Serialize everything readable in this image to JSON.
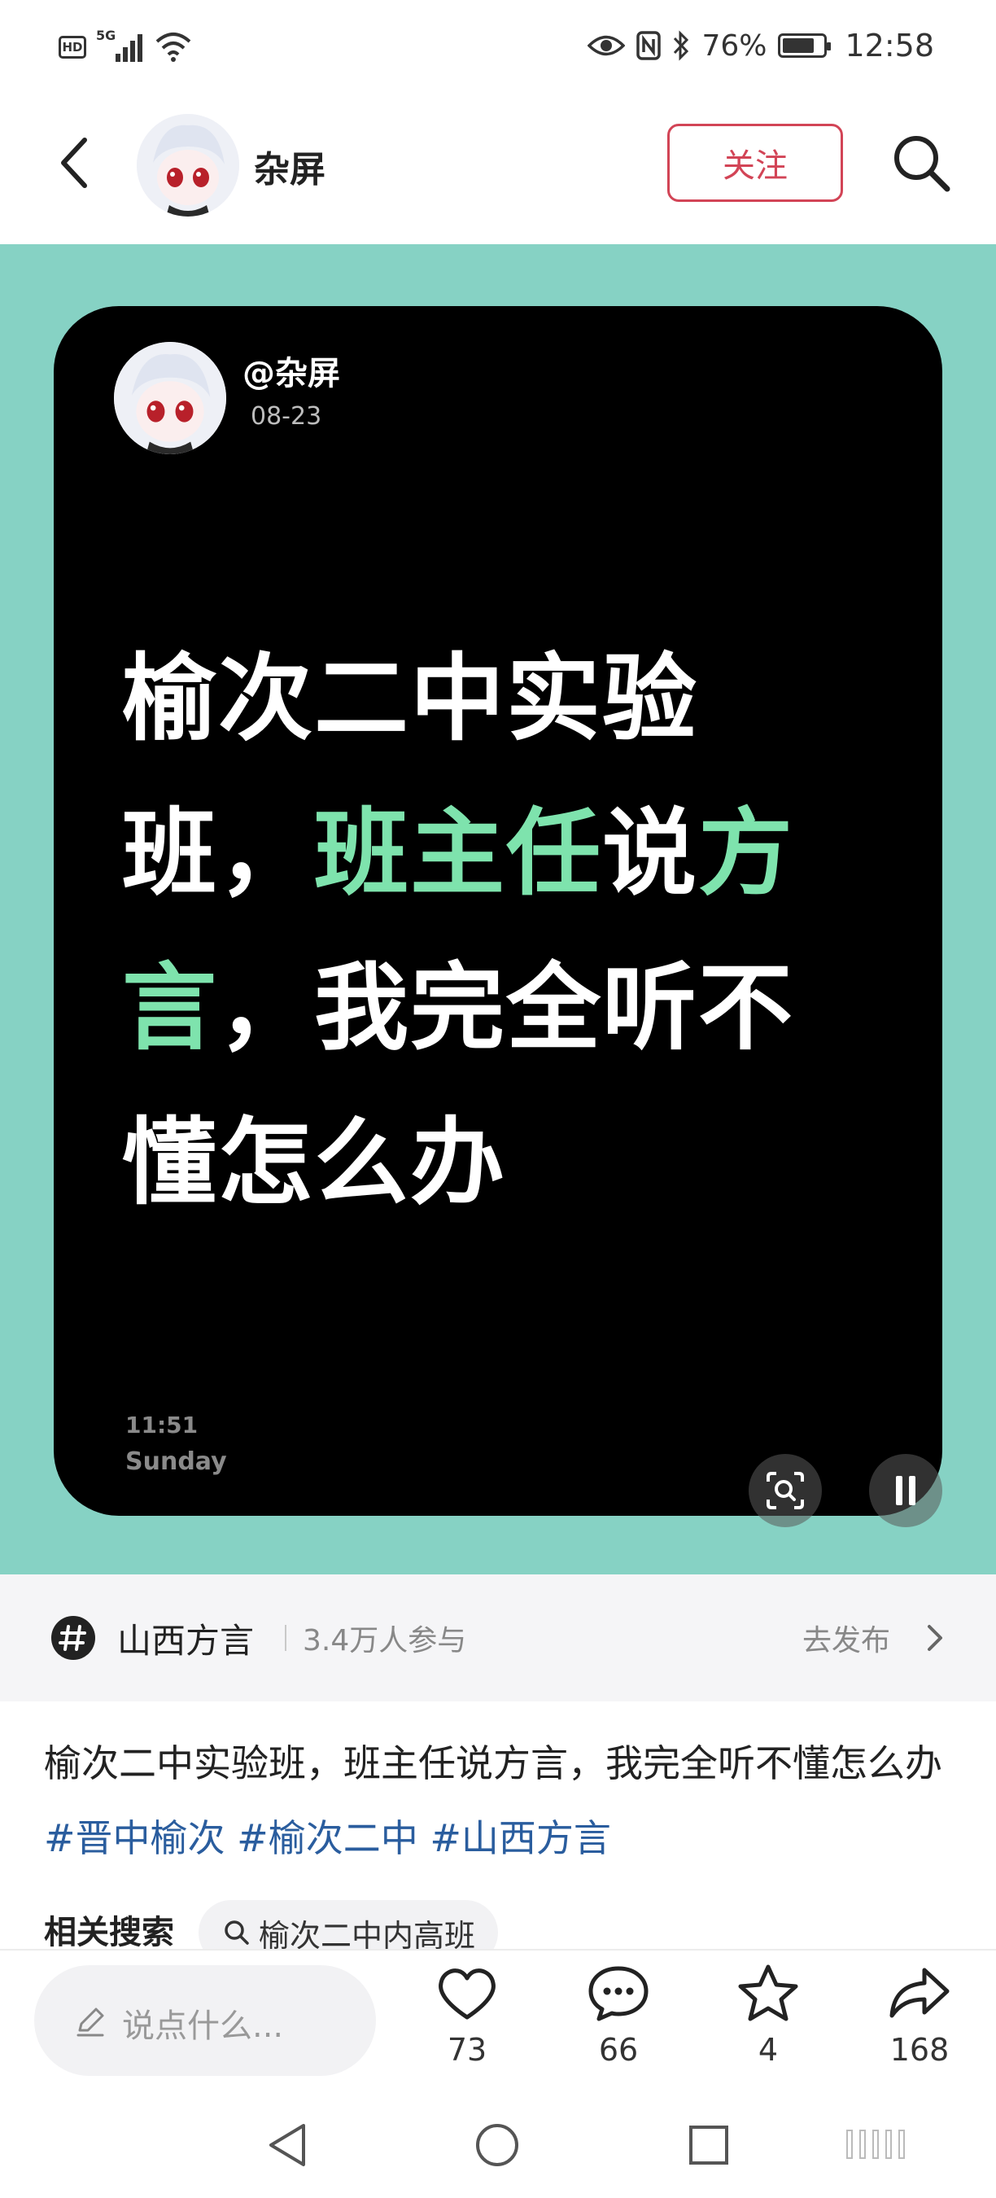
{
  "status_bar": {
    "hd_label": "HD",
    "network": "5G",
    "battery": "76%",
    "time": "12:58"
  },
  "header": {
    "username": "杂屏",
    "follow_label": "关注"
  },
  "post_image": {
    "handle": "@杂屏",
    "date": "08-23",
    "text_segments": [
      {
        "text": "榆次二中实验班，",
        "highlight": false
      },
      {
        "text": "班主任",
        "highlight": true
      },
      {
        "text": "说",
        "highlight": false
      },
      {
        "text": "方言",
        "highlight": true
      },
      {
        "text": "，我完全听不懂怎么办",
        "highlight": false
      }
    ],
    "clock": "11:51",
    "day": "Sunday",
    "highlight_color": "#7ee3ad",
    "background_color": "#86d2c4"
  },
  "topic": {
    "name": "山西方言",
    "participants": "3.4万人参与",
    "go_publish": "去发布"
  },
  "description": {
    "text": "榆次二中实验班，班主任说方言，我完全听不懂怎么办",
    "hashtags": [
      "#晋中榆次",
      "#榆次二中",
      "#山西方言"
    ]
  },
  "related": {
    "label": "相关搜索",
    "chip": "榆次二中内高班"
  },
  "bottom_bar": {
    "comment_placeholder": "说点什么...",
    "likes": "73",
    "comments": "66",
    "favorites": "4",
    "shares": "168"
  },
  "icons": {
    "back": "chevron-left-icon",
    "search": "search-icon",
    "topic": "hashtag-icon",
    "like": "heart-icon",
    "comment": "chat-bubble-icon",
    "favorite": "star-icon",
    "share": "share-arrow-icon"
  },
  "colors": {
    "accent_red": "#d24456",
    "hashtag_blue": "#2a5d9e"
  }
}
